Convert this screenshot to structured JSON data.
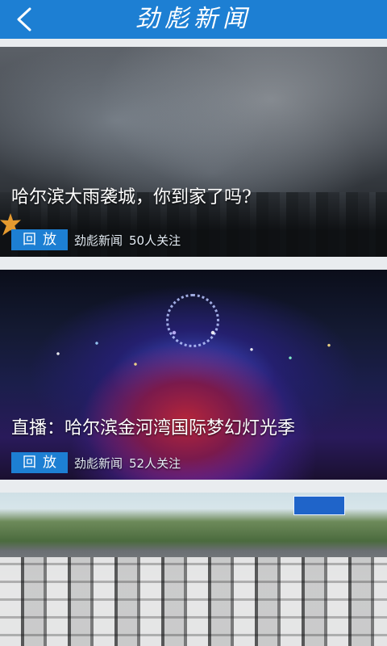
{
  "header": {
    "title": "劲彪新闻",
    "back_icon": "chevron-left-icon"
  },
  "colors": {
    "header_bg": "#1d7fd3",
    "replay_button_bg": "#1d7fd3",
    "page_bg": "#e9ecef"
  },
  "feed": {
    "items": [
      {
        "title": "哈尔滨大雨袭城，你到家了吗?",
        "button_label": "回放",
        "source": "劲彪新闻",
        "followers": "50人关注"
      },
      {
        "title": "直播：哈尔滨金河湾国际梦幻灯光季",
        "button_label": "回放",
        "source": "劲彪新闻",
        "followers": "52人关注"
      },
      {
        "title": "",
        "button_label": "",
        "source": "",
        "followers": ""
      }
    ]
  }
}
